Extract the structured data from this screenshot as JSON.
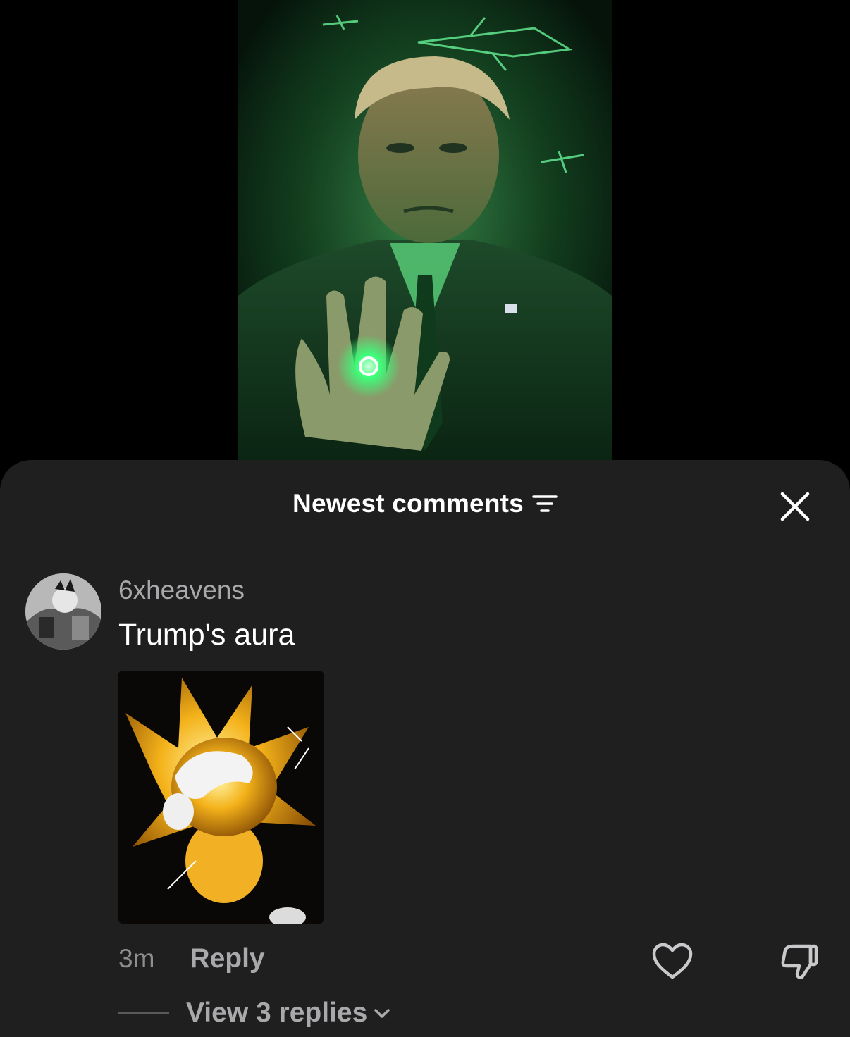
{
  "sheet": {
    "sort_label": "Newest comments",
    "sort_icon": "filter-lines-icon",
    "close_icon": "close-icon"
  },
  "comment": {
    "username": "6xheavens",
    "text": "Trump's aura",
    "timestamp": "3m",
    "reply_label": "Reply",
    "like_icon": "heart-outline-icon",
    "dislike_icon": "thumbs-down-outline-icon",
    "view_replies_label": "View 3 replies",
    "view_replies_icon": "chevron-down-icon"
  },
  "colors": {
    "sheet_background": "#1f1f20",
    "primary_text": "#ffffff",
    "secondary_text": "#a9a9ab",
    "video_glow": "#3cff7a"
  }
}
